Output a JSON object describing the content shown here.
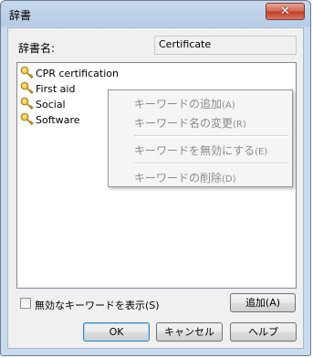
{
  "window": {
    "title": "辞書",
    "close_glyph": "✕"
  },
  "dictionary": {
    "label": "辞書名:",
    "value": "Certificate"
  },
  "keywords": [
    {
      "label": "CPR certification",
      "icon": "key-icon"
    },
    {
      "label": "First aid",
      "icon": "key-icon"
    },
    {
      "label": "Social",
      "icon": "key-icon"
    },
    {
      "label": "Software",
      "icon": "key-icon"
    }
  ],
  "context_menu": {
    "items": [
      {
        "label": "キーワードの追加",
        "accel": "(A)"
      },
      {
        "label": "キーワード名の変更",
        "accel": "(R)"
      },
      {
        "label": "キーワードを無効にする",
        "accel": "(E)"
      },
      {
        "label": "キーワードの削除",
        "accel": "(D)"
      }
    ]
  },
  "show_disabled": {
    "label": "無効なキーワードを表示(S)",
    "checked": false
  },
  "buttons": {
    "add": "追加(A)",
    "ok": "OK",
    "cancel": "キャンセル",
    "help": "ヘルプ"
  },
  "colors": {
    "key_gold": "#e2b13a",
    "disabled_text": "#8c8c8c"
  }
}
